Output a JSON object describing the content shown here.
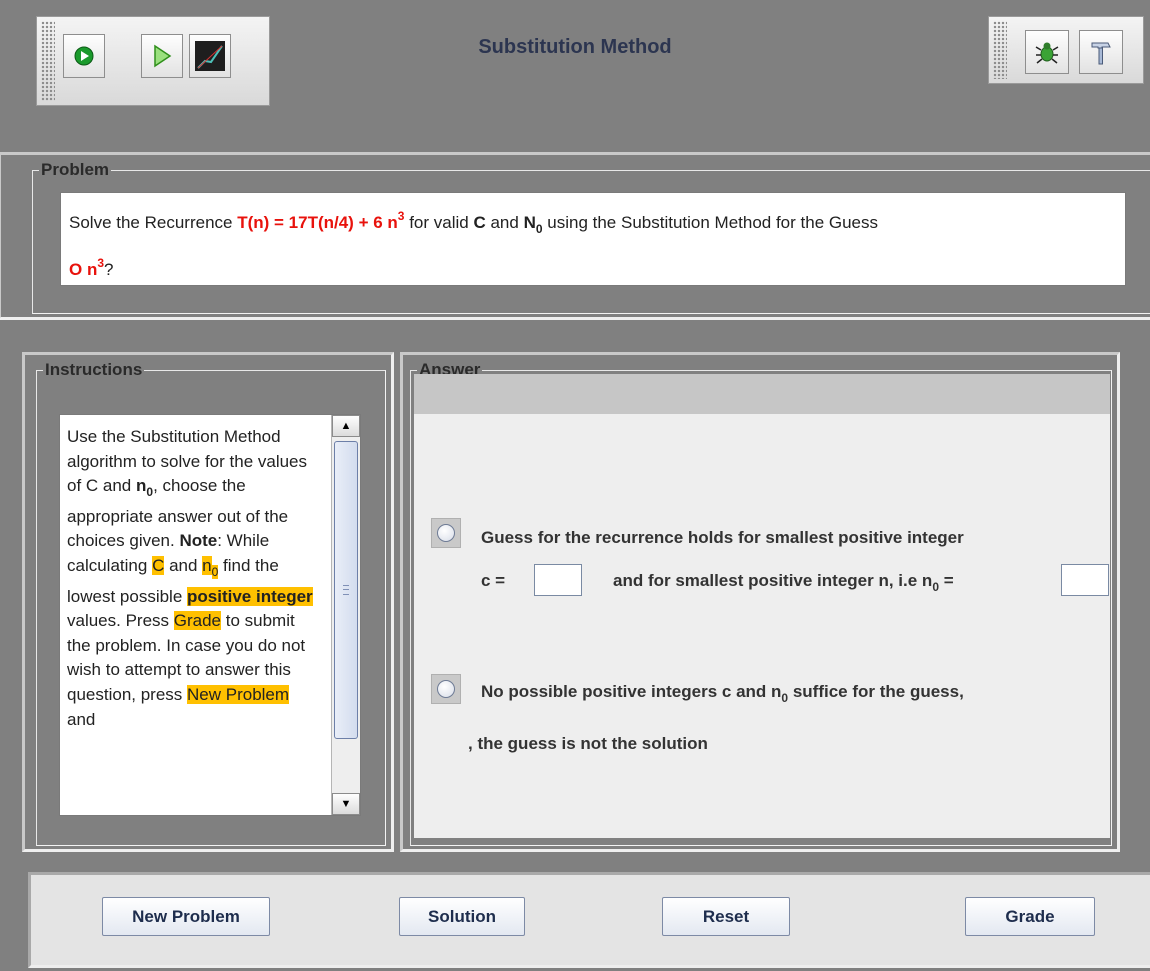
{
  "app": {
    "title": "Substitution Method"
  },
  "toolbar_left": [
    {
      "name": "run-icon",
      "label": "Run"
    },
    {
      "name": "play-icon",
      "label": "Play"
    },
    {
      "name": "graph-icon",
      "label": "Graph"
    }
  ],
  "toolbar_right": [
    {
      "name": "bug-icon",
      "label": "Debug"
    },
    {
      "name": "hammer-icon",
      "label": "Tools"
    }
  ],
  "problem": {
    "legend": "Problem",
    "text_prefix": "Solve the Recurrence ",
    "recurrence": "T(n) = 17T(n/4) + 6 n",
    "recurrence_exp": "3",
    "text_mid1": " for valid ",
    "c": "C",
    "text_mid2": " and ",
    "n": "N",
    "n_sub": "0",
    "text_mid3": " using the Substitution Method for the Guess",
    "guess": "O n",
    "guess_exp": "3",
    "text_end": "?"
  },
  "instructions": {
    "legend": "Instructions",
    "t1": "Use the Substitution Method algorithm to solve for the values of C and ",
    "n0_base": "n",
    "n0_sub": "0",
    "t2": ", choose the appropriate answer out of the choices given. ",
    "note": "Note",
    "t3": ": While calculating ",
    "hl_c": "C",
    "t4": " and ",
    "hl_n0_base": "n",
    "hl_n0_sub": "0",
    "t5": " find the lowest possible ",
    "hl_posint": "positive integer",
    "t6": " values. Press ",
    "hl_grade": "Grade",
    "t7": " to submit the problem. In case you do not wish to attempt to answer this question, press ",
    "hl_newproblem": "New Problem",
    "t8": " and"
  },
  "answer": {
    "legend": "Answer",
    "option1_line1": "Guess for the recurrence holds for smallest positive integer",
    "option1_c_label": "c =",
    "option1_c_value": "",
    "option1_n_label_pre": "and for smallest positive integer n, i.e n",
    "option1_n_label_sub": "0",
    "option1_n_label_post": " =",
    "option1_n_value": "",
    "option2_pre": "No possible positive integers c and n",
    "option2_sub": "0",
    "option2_post": " suffice for the guess,",
    "option2_line2": ", the guess is not the solution"
  },
  "buttons": {
    "new_problem": "New Problem",
    "solution": "Solution",
    "reset": "Reset",
    "grade": "Grade"
  }
}
